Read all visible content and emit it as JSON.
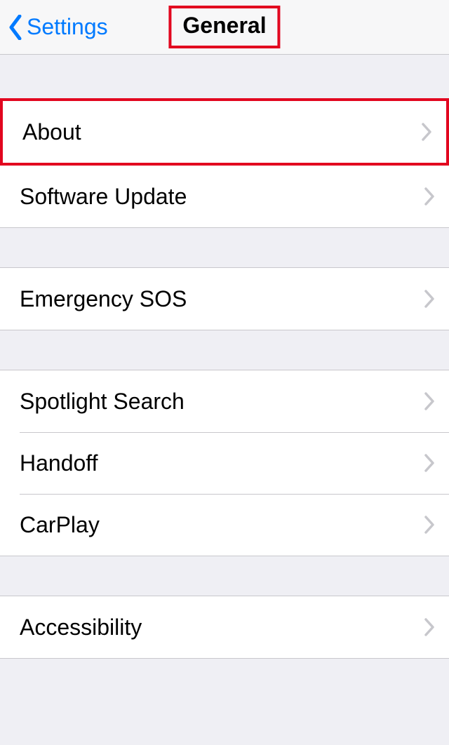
{
  "navbar": {
    "back_label": "Settings",
    "title": "General"
  },
  "groups": [
    {
      "items": [
        {
          "label": "About",
          "highlight": true
        },
        {
          "label": "Software Update"
        }
      ]
    },
    {
      "items": [
        {
          "label": "Emergency SOS"
        }
      ]
    },
    {
      "items": [
        {
          "label": "Spotlight Search"
        },
        {
          "label": "Handoff"
        },
        {
          "label": "CarPlay"
        }
      ]
    },
    {
      "items": [
        {
          "label": "Accessibility"
        }
      ]
    }
  ]
}
